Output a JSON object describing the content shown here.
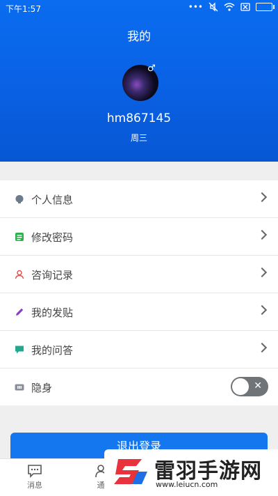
{
  "status_bar": {
    "time": "下午1:57",
    "dots": "•••"
  },
  "header": {
    "title": "我的",
    "username": "hm867145",
    "subtitle": "周三",
    "gender_symbol": "♂"
  },
  "menu": {
    "items": [
      {
        "label": "个人信息",
        "icon": "github-icon",
        "icon_color": "#6b7b8c"
      },
      {
        "label": "修改密码",
        "icon": "notepad-icon",
        "icon_color": "#2bb24c"
      },
      {
        "label": "咨询记录",
        "icon": "user-icon",
        "icon_color": "#e2504f"
      },
      {
        "label": "我的发贴",
        "icon": "pencil-icon",
        "icon_color": "#8a3cc6"
      },
      {
        "label": "我的问答",
        "icon": "chat-icon",
        "icon_color": "#23a78f"
      }
    ],
    "stealth": {
      "label": "隐身",
      "enabled": false
    }
  },
  "logout_button": "退出登录",
  "tabbar": [
    {
      "label": "消息",
      "icon": "message-icon"
    },
    {
      "label": "通",
      "icon": "contacts-icon"
    }
  ],
  "watermark": {
    "title": "雷羽手游网",
    "url": "www.leiucn.com"
  },
  "colors": {
    "primary": "#0a63e6",
    "toggle_off": "#6f7479"
  }
}
